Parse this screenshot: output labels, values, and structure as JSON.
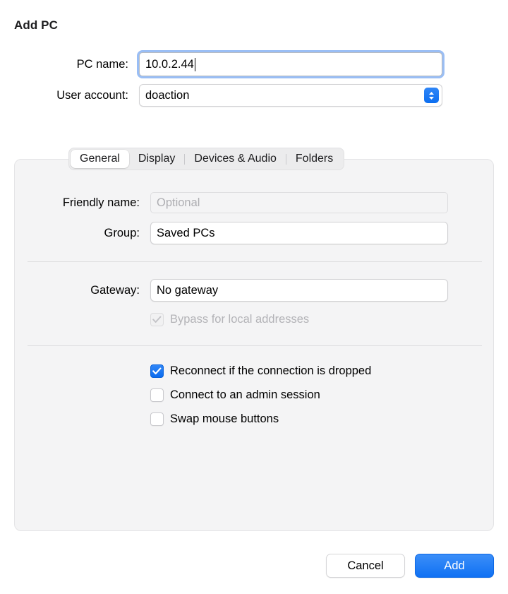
{
  "dialog": {
    "title": "Add PC"
  },
  "top_form": {
    "pc_name": {
      "label": "PC name:",
      "value": "10.0.2.44",
      "placeholder": ""
    },
    "user_account": {
      "label": "User account:",
      "value": "doaction"
    }
  },
  "tabs": [
    {
      "label": "General",
      "active": true
    },
    {
      "label": "Display",
      "active": false
    },
    {
      "label": "Devices & Audio",
      "active": false
    },
    {
      "label": "Folders",
      "active": false
    }
  ],
  "general_tab": {
    "friendly_name": {
      "label": "Friendly name:",
      "value": "",
      "placeholder": "Optional"
    },
    "group": {
      "label": "Group:",
      "value": "Saved PCs"
    },
    "gateway": {
      "label": "Gateway:",
      "value": "No gateway"
    },
    "bypass": {
      "label": "Bypass for local addresses",
      "checked": true,
      "disabled": true
    },
    "options": [
      {
        "label": "Reconnect if the connection is dropped",
        "checked": true
      },
      {
        "label": "Connect to an admin session",
        "checked": false
      },
      {
        "label": "Swap mouse buttons",
        "checked": false
      }
    ]
  },
  "footer": {
    "cancel_label": "Cancel",
    "add_label": "Add"
  },
  "colors": {
    "accent_blue": "#1071f3",
    "focus_ring": "#649bf0",
    "panel_bg": "#f4f4f5",
    "disabled_text": "#b3b3b7",
    "placeholder_text": "#aeaeb2"
  }
}
